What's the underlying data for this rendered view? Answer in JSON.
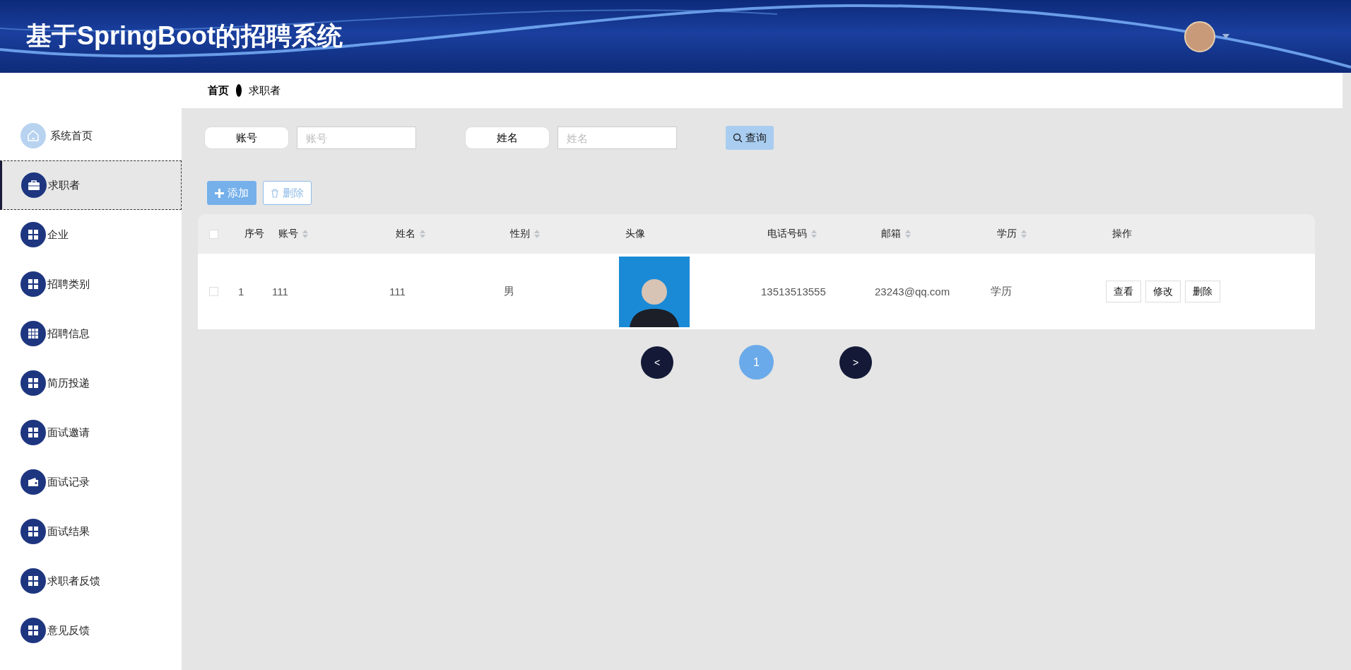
{
  "header": {
    "title": "基于SpringBoot的招聘系统"
  },
  "breadcrumb": {
    "items": [
      "首页",
      "求职者"
    ]
  },
  "sidebar": {
    "items": [
      {
        "label": "系统首页",
        "kind": "home",
        "selected": false
      },
      {
        "label": "求职者",
        "kind": "briefcase",
        "selected": true
      },
      {
        "label": "企业",
        "kind": "grid",
        "selected": false
      },
      {
        "label": "招聘类别",
        "kind": "grid",
        "selected": false
      },
      {
        "label": "招聘信息",
        "kind": "table",
        "selected": false
      },
      {
        "label": "简历投递",
        "kind": "grid",
        "selected": false
      },
      {
        "label": "面试邀请",
        "kind": "grid",
        "selected": false
      },
      {
        "label": "面试记录",
        "kind": "wallet",
        "selected": false
      },
      {
        "label": "面试结果",
        "kind": "grid",
        "selected": false
      },
      {
        "label": "求职者反馈",
        "kind": "grid",
        "selected": false
      },
      {
        "label": "意见反馈",
        "kind": "grid",
        "selected": false
      }
    ]
  },
  "search": {
    "fields": [
      {
        "label": "账号",
        "placeholder": "账号"
      },
      {
        "label": "姓名",
        "placeholder": "姓名"
      }
    ],
    "button": "查询"
  },
  "actions": [
    {
      "label": "添加",
      "kind": "add"
    },
    {
      "label": "删除",
      "kind": "delete"
    }
  ],
  "table": {
    "columns": [
      {
        "label": "序号",
        "sortable": false,
        "kind": "text"
      },
      {
        "label": "账号",
        "sortable": true,
        "kind": "text"
      },
      {
        "label": "姓名",
        "sortable": true,
        "kind": "text"
      },
      {
        "label": "性别",
        "sortable": true,
        "kind": "text"
      },
      {
        "label": "头像",
        "sortable": false,
        "kind": "image"
      },
      {
        "label": "电话号码",
        "sortable": true,
        "kind": "text"
      },
      {
        "label": "邮箱",
        "sortable": true,
        "kind": "text"
      },
      {
        "label": "学历",
        "sortable": true,
        "kind": "text"
      },
      {
        "label": "操作",
        "sortable": false,
        "kind": "actions"
      }
    ],
    "header_checked": false,
    "rows": [
      {
        "checked": false,
        "cells": [
          "1",
          "111",
          "111",
          "男",
          "",
          "13513513555",
          "23243@qq.com",
          "学历"
        ],
        "buttons": [
          "查看",
          "修改",
          "删除"
        ]
      }
    ]
  },
  "pagination": {
    "prev": "<",
    "pages": [
      {
        "label": "1",
        "selected": true
      }
    ],
    "next": ">"
  }
}
